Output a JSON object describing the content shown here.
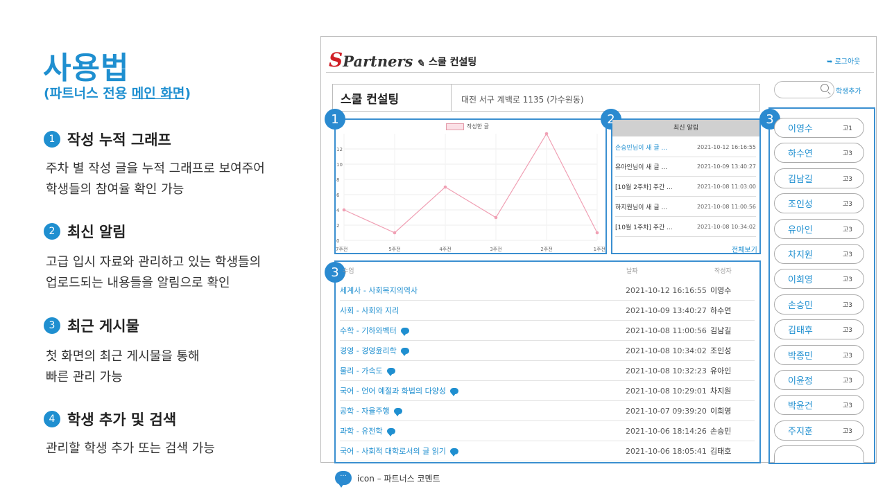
{
  "guide": {
    "title": "사용법",
    "subtitle_prefix": "(파트너스 전용 ",
    "subtitle_underlined": "메인 화면",
    "subtitle_suffix": ")",
    "sections": [
      {
        "num": "1",
        "heading": "작성 누적 그래프",
        "lines": [
          "주차 별 작성 글을 누적 그래프로 보여주어",
          "학생들의 참여율 확인 가능"
        ]
      },
      {
        "num": "2",
        "heading": "최신 알림",
        "lines": [
          "고급 입시 자료와 관리하고 있는 학생들의",
          "업로드되는 내용들을 알림으로 확인"
        ]
      },
      {
        "num": "3",
        "heading": "최근 게시물",
        "lines": [
          "첫 화면의 최근 게시물을 통해",
          "빠른 관리 가능"
        ]
      },
      {
        "num": "4",
        "heading": "학생 추가 및 검색",
        "lines": [
          "관리할 학생 추가 또는 검색 가능"
        ]
      }
    ]
  },
  "app": {
    "logo_s": "S",
    "logo_rest": "Partners",
    "name": "스쿨 컨설팅",
    "logout": "로그아웃",
    "school_name": "스쿨 컨설팅",
    "school_address": "대전 서구 계백로 1135 (가수원동)",
    "add_student": "학생추가",
    "search_placeholder": ""
  },
  "badges": {
    "chart": "1",
    "notice": "2",
    "posts": "3",
    "students": "3"
  },
  "chart_data": {
    "type": "line",
    "legend": "작성한 글",
    "categories": [
      "7주전",
      "5주전",
      "4주전",
      "3주전",
      "2주전",
      "1주전"
    ],
    "values": [
      4,
      1,
      7,
      3,
      14,
      1
    ],
    "yticks": [
      "0",
      "2",
      "4",
      "6",
      "8",
      "10",
      "12"
    ],
    "ylim": [
      0,
      14
    ],
    "color": "#f0a0b4",
    "grid": true
  },
  "notices": {
    "header": "최신 알림",
    "more": "전체보기",
    "items": [
      {
        "title": "손승민님이 새 글 ...",
        "date": "2021-10-12 16:16:55",
        "highlight": true
      },
      {
        "title": "유아인님이 새 글 ...",
        "date": "2021-10-09 13:40:27",
        "highlight": false
      },
      {
        "title": "[10월 2주차] 주간 ...",
        "date": "2021-10-08 11:03:00",
        "highlight": false
      },
      {
        "title": "하지원님이 새 글 ...",
        "date": "2021-10-08 11:00:56",
        "highlight": false
      },
      {
        "title": "[10월 1주차] 주간 ...",
        "date": "2021-10-08 10:34:02",
        "highlight": false
      }
    ]
  },
  "posts": {
    "head_title": "수업",
    "head_date": "날짜",
    "head_author": "작성자",
    "rows": [
      {
        "title": "세계사 - 사회복지의역사",
        "date": "2021-10-12 16:16:55",
        "author": "이영수",
        "comment": false
      },
      {
        "title": "사회 - 사회와 지리",
        "date": "2021-10-09 13:40:27",
        "author": "하수연",
        "comment": false
      },
      {
        "title": "수학 - 기하와벡터",
        "date": "2021-10-08 11:00:56",
        "author": "김남길",
        "comment": true
      },
      {
        "title": "경영 - 경영윤리학",
        "date": "2021-10-08 10:34:02",
        "author": "조인성",
        "comment": true
      },
      {
        "title": "물리 - 가속도",
        "date": "2021-10-08 10:32:23",
        "author": "유아인",
        "comment": true
      },
      {
        "title": "국어 - 언어 예절과 화법의 다양성",
        "date": "2021-10-08 10:29:01",
        "author": "차지원",
        "comment": true
      },
      {
        "title": "공학 - 자율주행",
        "date": "2021-10-07 09:39:20",
        "author": "이희영",
        "comment": true
      },
      {
        "title": "과학 - 유전학",
        "date": "2021-10-06 18:14:26",
        "author": "손승민",
        "comment": true
      },
      {
        "title": "국어 - 사회적 대학로서의 글 읽기",
        "date": "2021-10-06 18:05:41",
        "author": "김태호",
        "comment": true
      }
    ]
  },
  "students": [
    {
      "name": "이영수",
      "grade": "고1"
    },
    {
      "name": "하수연",
      "grade": "고3"
    },
    {
      "name": "김남길",
      "grade": "고3"
    },
    {
      "name": "조인성",
      "grade": "고3"
    },
    {
      "name": "유아인",
      "grade": "고3"
    },
    {
      "name": "차지원",
      "grade": "고3"
    },
    {
      "name": "이희영",
      "grade": "고3"
    },
    {
      "name": "손승민",
      "grade": "고3"
    },
    {
      "name": "김태후",
      "grade": "고3"
    },
    {
      "name": "박종민",
      "grade": "고3"
    },
    {
      "name": "이윤정",
      "grade": "고3"
    },
    {
      "name": "박윤건",
      "grade": "고3"
    },
    {
      "name": "주지훈",
      "grade": "고3"
    },
    {
      "name": "",
      "grade": ""
    }
  ],
  "footnote": {
    "icon_text": "···",
    "text": "icon – 파트너스 코멘트"
  }
}
